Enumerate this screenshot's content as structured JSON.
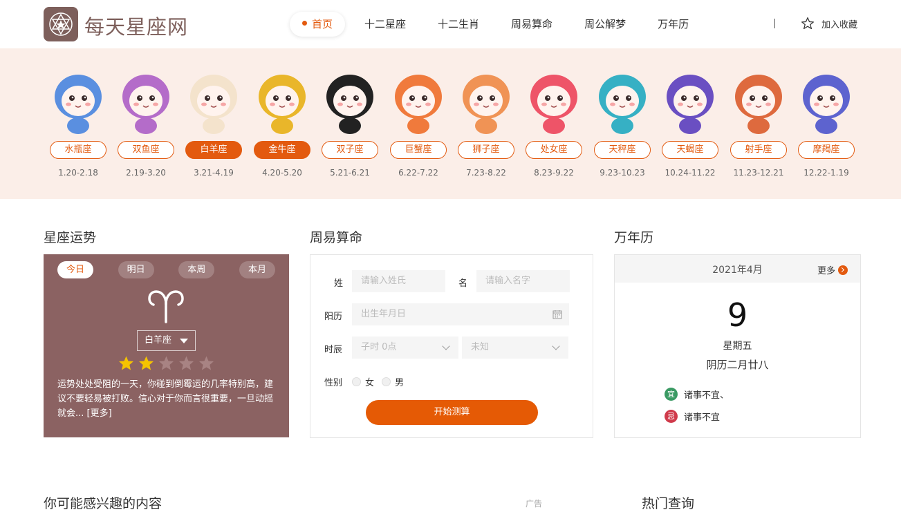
{
  "site": {
    "name": "每天星座网"
  },
  "nav": {
    "items": [
      {
        "label": "首页",
        "active": true
      },
      {
        "label": "十二星座"
      },
      {
        "label": "十二生肖"
      },
      {
        "label": "周易算命"
      },
      {
        "label": "周公解梦"
      },
      {
        "label": "万年历"
      }
    ],
    "favorite": "加入收藏"
  },
  "zodiacs": [
    {
      "name": "水瓶座",
      "date": "1.20-2.18",
      "color": "#5a8fe0"
    },
    {
      "name": "双鱼座",
      "date": "2.19-3.20",
      "color": "#b46cc9"
    },
    {
      "name": "白羊座",
      "date": "3.21-4.19",
      "color": "#f4e3cc",
      "selected": true
    },
    {
      "name": "金牛座",
      "date": "4.20-5.20",
      "color": "#e9b62a",
      "selected": true
    },
    {
      "name": "双子座",
      "date": "5.21-6.21",
      "color": "#444444"
    },
    {
      "name": "巨蟹座",
      "date": "6.22-7.22",
      "color": "#f07a3c"
    },
    {
      "name": "狮子座",
      "date": "7.23-8.22",
      "color": "#f09355"
    },
    {
      "name": "处女座",
      "date": "8.23-9.22",
      "color": "#ee5468"
    },
    {
      "name": "天秤座",
      "date": "9.23-10.23",
      "color": "#36b0c4"
    },
    {
      "name": "天蝎座",
      "date": "10.24-11.22",
      "color": "#6a4fc2"
    },
    {
      "name": "射手座",
      "date": "11.23-12.21",
      "color": "#de6a3e"
    },
    {
      "name": "摩羯座",
      "date": "12.22-1.19",
      "color": "#5d63cf"
    }
  ],
  "sections": {
    "fortune_title": "星座运势",
    "divine_title": "周易算命",
    "calendar_title": "万年历",
    "interest_title": "你可能感兴趣的内容",
    "hot_title": "热门查询",
    "mid_text": "广告"
  },
  "fortune": {
    "tabs": [
      "今日",
      "明日",
      "本周",
      "本月"
    ],
    "active_tab": 0,
    "sign": "白羊座",
    "stars_filled": 2,
    "stars_total": 5,
    "description": "运势处处受阻的一天，你碰到倒霉运的几率特别高，建议不要轻易被打败。信心对于你而言很重要，一旦动摇就会... [更多]"
  },
  "divine": {
    "surname_label": "姓",
    "surname_placeholder": "请输入姓氏",
    "name_label": "名",
    "name_placeholder": "请输入名字",
    "solar_label": "阳历",
    "solar_placeholder": "出生年月日",
    "hour_label": "时辰",
    "hour_value": "子时 0点",
    "unknown_value": "未知",
    "gender_label": "性别",
    "female": "女",
    "male": "男",
    "submit": "开始测算"
  },
  "calendar": {
    "month": "2021年4月",
    "more": "更多",
    "day": "9",
    "weekday": "星期五",
    "lunar": "阴历二月廿八",
    "yi_badge": "宜",
    "yi_text": "诸事不宜、",
    "ji_badge": "忌",
    "ji_text": "诸事不宜",
    "yi_color": "#3a9a63",
    "ji_color": "#d03a4b"
  },
  "colors": {
    "accent": "#e35a0f",
    "brand": "#7d5f5b",
    "card": "#8b6262",
    "band": "#fbeee8"
  }
}
